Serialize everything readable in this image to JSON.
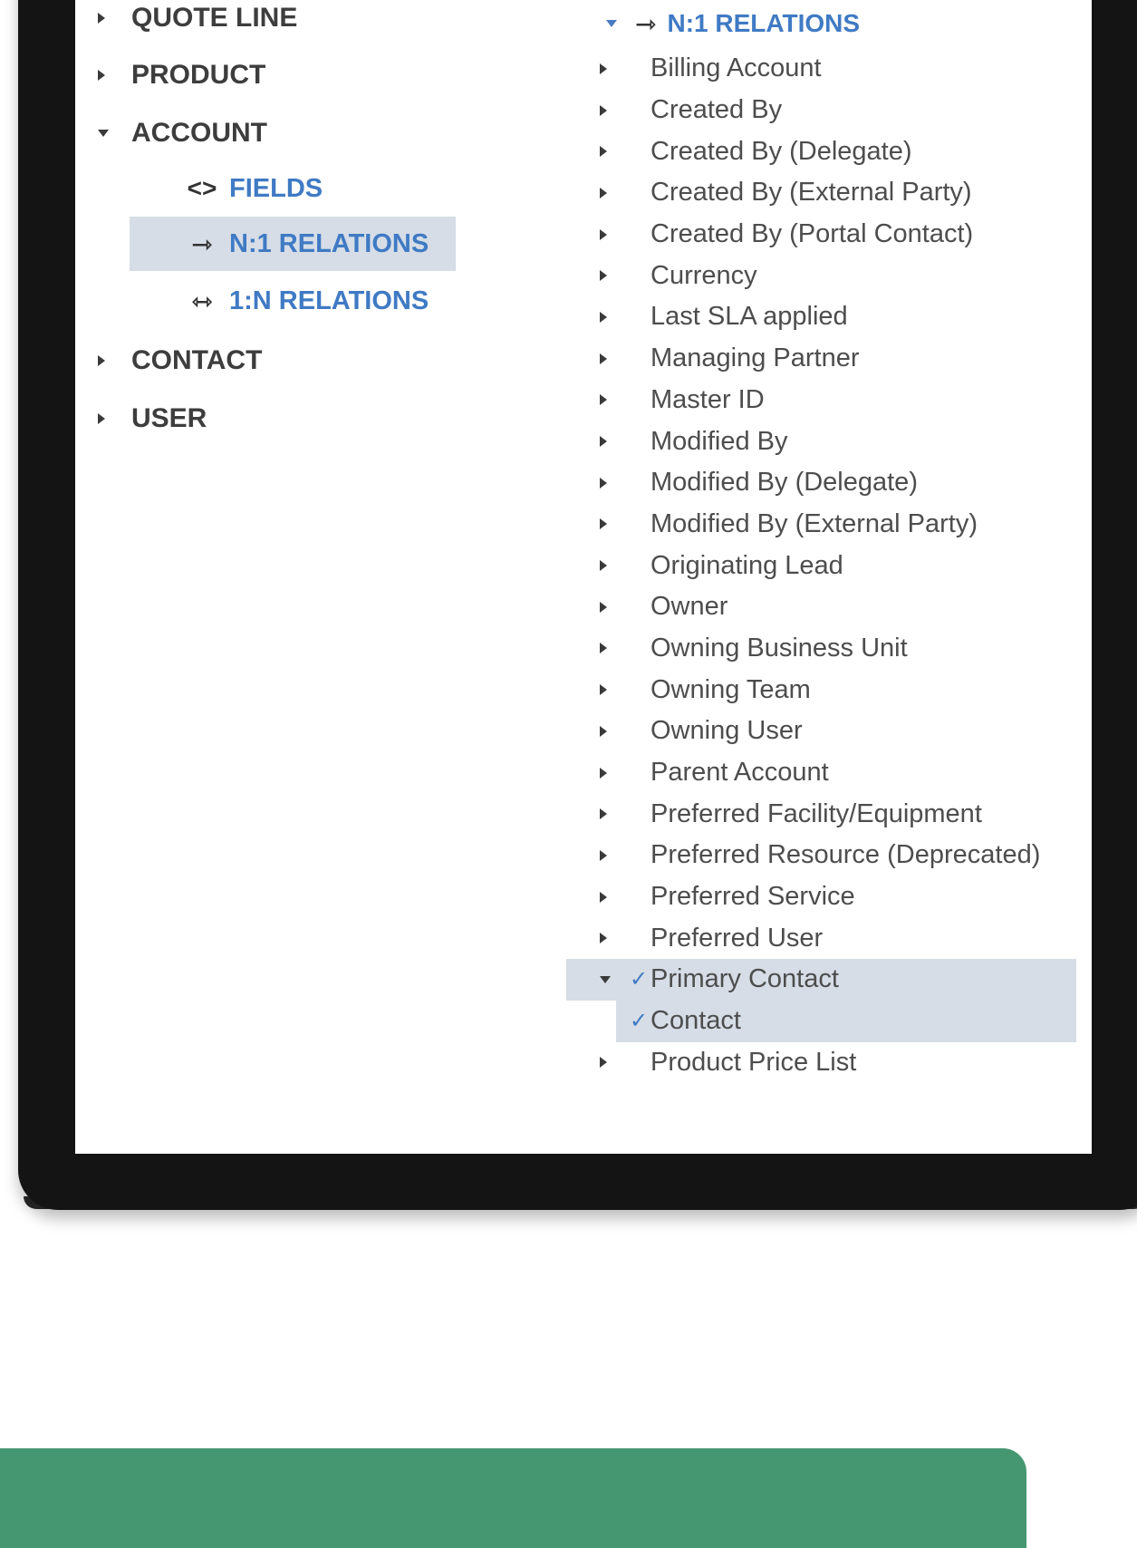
{
  "left_tree": {
    "quote_line": "QUOTE LINE",
    "product": "PRODUCT",
    "account": "ACCOUNT",
    "fields": "FIELDS",
    "n1_relations": "N:1 RELATIONS",
    "1n_relations": "1:N RELATIONS",
    "contact": "CONTACT",
    "user": "USER"
  },
  "right_tree": {
    "header": "N:1 RELATIONS",
    "items": [
      "Billing Account",
      "Created By",
      "Created By (Delegate)",
      "Created By (External Party)",
      "Created By (Portal Contact)",
      "Currency",
      "Last SLA applied",
      "Managing Partner",
      "Master ID",
      "Modified By",
      "Modified By (Delegate)",
      "Modified By (External Party)",
      "Originating Lead",
      "Owner",
      "Owning Business Unit",
      "Owning Team",
      "Owning User",
      "Parent Account",
      "Preferred Facility/Equipment",
      "Preferred Resource (Deprecated)",
      "Preferred Service",
      "Preferred User"
    ],
    "selected_item": "Primary Contact",
    "selected_child": "Contact",
    "last_item": "Product Price List"
  },
  "colors": {
    "accent_blue": "#3f7ac4",
    "selection_bg": "#d6dde6",
    "banner_green": "#459772",
    "device_bezel": "#141414"
  }
}
